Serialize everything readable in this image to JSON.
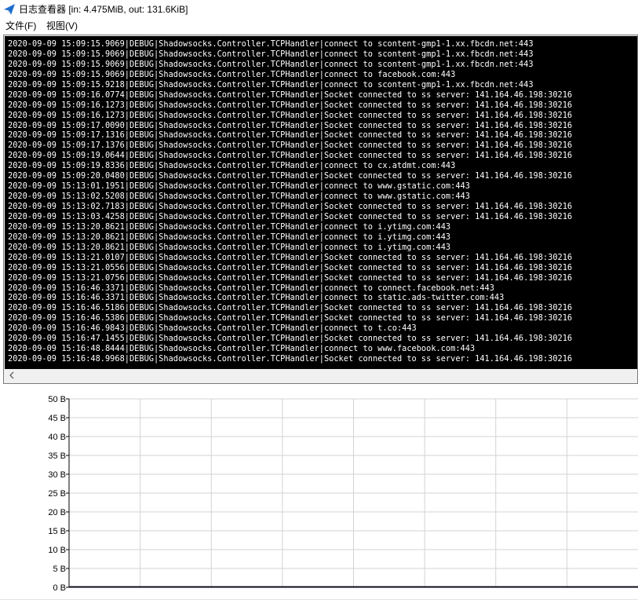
{
  "window": {
    "title": "日志查看器 [in: 4.475MiB, out: 131.6KiB]",
    "icon": "paper-plane-icon"
  },
  "menu": {
    "file_label": "文件(F)",
    "view_label": "视图(V)"
  },
  "log": {
    "lines": [
      "2020-09-09 15:09:15.9069|DEBUG|Shadowsocks.Controller.TCPHandler|connect to scontent-gmp1-1.xx.fbcdn.net:443",
      "2020-09-09 15:09:15.9069|DEBUG|Shadowsocks.Controller.TCPHandler|connect to scontent-gmp1-1.xx.fbcdn.net:443",
      "2020-09-09 15:09:15.9069|DEBUG|Shadowsocks.Controller.TCPHandler|connect to scontent-gmp1-1.xx.fbcdn.net:443",
      "2020-09-09 15:09:15.9069|DEBUG|Shadowsocks.Controller.TCPHandler|connect to facebook.com:443",
      "2020-09-09 15:09:15.9218|DEBUG|Shadowsocks.Controller.TCPHandler|connect to scontent-gmp1-1.xx.fbcdn.net:443",
      "2020-09-09 15:09:16.0774|DEBUG|Shadowsocks.Controller.TCPHandler|Socket connected to ss server: 141.164.46.198:30216",
      "2020-09-09 15:09:16.1273|DEBUG|Shadowsocks.Controller.TCPHandler|Socket connected to ss server: 141.164.46.198:30216",
      "2020-09-09 15:09:16.1273|DEBUG|Shadowsocks.Controller.TCPHandler|Socket connected to ss server: 141.164.46.198:30216",
      "2020-09-09 15:09:17.0090|DEBUG|Shadowsocks.Controller.TCPHandler|Socket connected to ss server: 141.164.46.198:30216",
      "2020-09-09 15:09:17.1316|DEBUG|Shadowsocks.Controller.TCPHandler|Socket connected to ss server: 141.164.46.198:30216",
      "2020-09-09 15:09:17.1376|DEBUG|Shadowsocks.Controller.TCPHandler|Socket connected to ss server: 141.164.46.198:30216",
      "2020-09-09 15:09:19.0644|DEBUG|Shadowsocks.Controller.TCPHandler|Socket connected to ss server: 141.164.46.198:30216",
      "2020-09-09 15:09:19.8336|DEBUG|Shadowsocks.Controller.TCPHandler|connect to cx.atdmt.com:443",
      "2020-09-09 15:09:20.0480|DEBUG|Shadowsocks.Controller.TCPHandler|Socket connected to ss server: 141.164.46.198:30216",
      "2020-09-09 15:13:01.1951|DEBUG|Shadowsocks.Controller.TCPHandler|connect to www.gstatic.com:443",
      "2020-09-09 15:13:02.5208|DEBUG|Shadowsocks.Controller.TCPHandler|connect to www.gstatic.com:443",
      "2020-09-09 15:13:02.7183|DEBUG|Shadowsocks.Controller.TCPHandler|Socket connected to ss server: 141.164.46.198:30216",
      "2020-09-09 15:13:03.4258|DEBUG|Shadowsocks.Controller.TCPHandler|Socket connected to ss server: 141.164.46.198:30216",
      "2020-09-09 15:13:20.8621|DEBUG|Shadowsocks.Controller.TCPHandler|connect to i.ytimg.com:443",
      "2020-09-09 15:13:20.8621|DEBUG|Shadowsocks.Controller.TCPHandler|connect to i.ytimg.com:443",
      "2020-09-09 15:13:20.8621|DEBUG|Shadowsocks.Controller.TCPHandler|connect to i.ytimg.com:443",
      "2020-09-09 15:13:21.0107|DEBUG|Shadowsocks.Controller.TCPHandler|Socket connected to ss server: 141.164.46.198:30216",
      "2020-09-09 15:13:21.0556|DEBUG|Shadowsocks.Controller.TCPHandler|Socket connected to ss server: 141.164.46.198:30216",
      "2020-09-09 15:13:21.0756|DEBUG|Shadowsocks.Controller.TCPHandler|Socket connected to ss server: 141.164.46.198:30216",
      "2020-09-09 15:16:46.3371|DEBUG|Shadowsocks.Controller.TCPHandler|connect to connect.facebook.net:443",
      "2020-09-09 15:16:46.3371|DEBUG|Shadowsocks.Controller.TCPHandler|connect to static.ads-twitter.com:443",
      "2020-09-09 15:16:46.5186|DEBUG|Shadowsocks.Controller.TCPHandler|Socket connected to ss server: 141.164.46.198:30216",
      "2020-09-09 15:16:46.5386|DEBUG|Shadowsocks.Controller.TCPHandler|Socket connected to ss server: 141.164.46.198:30216",
      "2020-09-09 15:16:46.9843|DEBUG|Shadowsocks.Controller.TCPHandler|connect to t.co:443",
      "2020-09-09 15:16:47.1455|DEBUG|Shadowsocks.Controller.TCPHandler|Socket connected to ss server: 141.164.46.198:30216",
      "2020-09-09 15:16:48.8444|DEBUG|Shadowsocks.Controller.TCPHandler|connect to www.facebook.com:443",
      "2020-09-09 15:16:48.9968|DEBUG|Shadowsocks.Controller.TCPHandler|Socket connected to ss server: 141.164.46.198:30216"
    ],
    "colors": {
      "background": "#000000",
      "text": "#ffffff"
    }
  },
  "scrollbar": {
    "left_icon": "chevron-left-icon"
  },
  "chart_data": {
    "type": "line",
    "title": "",
    "xlabel": "",
    "ylabel": "",
    "y_ticks": [
      "50 B",
      "45 B",
      "40 B",
      "35 B",
      "30 B",
      "25 B",
      "20 B",
      "15 B",
      "10 B",
      "5 B",
      "0 B"
    ],
    "ylim": [
      0,
      50
    ],
    "grid": true,
    "x_gridlines": 8,
    "series": [
      {
        "values": [
          0,
          0,
          0,
          0,
          0,
          0,
          0,
          0,
          0,
          0,
          0,
          0,
          0,
          0,
          0,
          0
        ],
        "color": "#000080"
      },
      {
        "values": [
          0,
          0,
          0,
          0,
          0,
          0,
          0,
          0,
          0,
          0,
          0,
          0,
          0,
          0,
          0,
          0
        ],
        "color": "#000000"
      }
    ],
    "colors": {
      "grid": "#d3d3d3",
      "axis": "#000000"
    }
  }
}
